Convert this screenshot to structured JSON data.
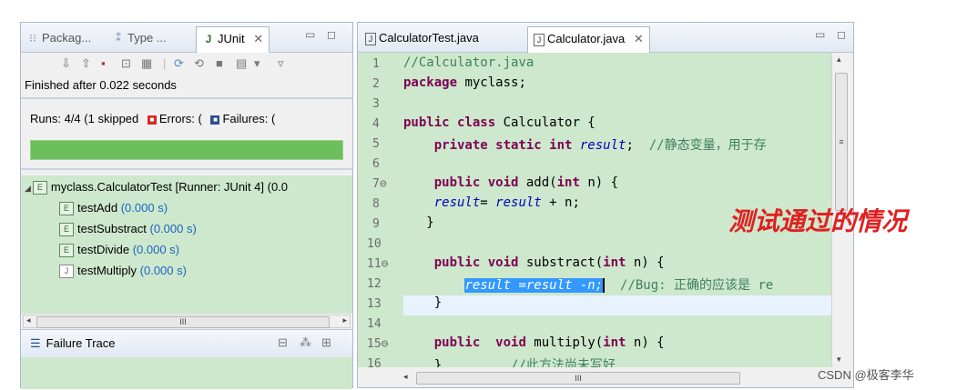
{
  "left_panel": {
    "tabs": [
      {
        "label": "Packag...",
        "icon": "package-explorer-icon"
      },
      {
        "label": "Type ...",
        "icon": "type-hierarchy-icon"
      },
      {
        "label": "JUnit",
        "icon": "junit-icon",
        "close": "✕"
      }
    ],
    "finished": "Finished after 0.022 seconds",
    "runs_label": "Runs:",
    "runs_value": "4/4 (1 skipped",
    "errors_label": "Errors:",
    "errors_value": "(",
    "failures_label": "Failures:",
    "failures_value": "(",
    "progress_fraction": 1.0,
    "tree": {
      "root": "myclass.CalculatorTest [Runner: JUnit 4] (0.0",
      "items": [
        {
          "name": "testAdd",
          "time": "(0.000 s)"
        },
        {
          "name": "testSubstract",
          "time": "(0.000 s)"
        },
        {
          "name": "testDivide",
          "time": "(0.000 s)"
        },
        {
          "name": "testMultiply",
          "time": "(0.000 s)"
        }
      ]
    },
    "scroll_label": "III",
    "failure_trace": "Failure Trace"
  },
  "editor": {
    "tabs": [
      {
        "label": "CalculatorTest.java"
      },
      {
        "label": "Calculator.java",
        "close": "✕"
      }
    ],
    "line_numbers": [
      "1",
      "2",
      "3",
      "4",
      "5",
      "6",
      "7⊖",
      "8",
      "9",
      "10",
      "11⊖",
      "12",
      "13",
      "14",
      "15⊖",
      "16"
    ],
    "lines": {
      "l1": "//Calculator.java",
      "l2_kw": "package",
      "l2_rest": " myclass;",
      "l4_kw": "public class",
      "l4_rest": " Calculator {",
      "l5_kw": "private static int",
      "l5_var": "result",
      "l5_end": ";",
      "l5_cm": "//静态变量，用于存",
      "l7_kw": "public void",
      "l7_mid": " add(",
      "l7_kw2": "int",
      "l7_end": " n) {",
      "l8_var1": "result",
      "l8_mid": "= ",
      "l8_var2": "result",
      "l8_end": " + n;",
      "l9": "}",
      "l11_kw": "public void",
      "l11_mid": " substract(",
      "l11_kw2": "int",
      "l11_end": " n) {",
      "l12_sel": "result =result -n;",
      "l12_cm": "//Bug: 正确的应该是 re",
      "l13": "}",
      "l15_kw": "public",
      "l15_kw2": "void",
      "l15_mid": " multiply(",
      "l15_kw3": "int",
      "l15_end": " n) {",
      "l16_brace": "}",
      "l16_cm": "//此方法尚未写好"
    },
    "scroll_label": "III"
  },
  "overlay_text": "测试通过的情况",
  "watermark": "CSDN @极客李华",
  "colors": {
    "editor_bg": "#cde8cc",
    "progress_green": "#6cbf5c",
    "keyword": "#7f0055",
    "comment": "#3f7f5f",
    "field": "#0000c0",
    "overlay": "#e02020"
  }
}
